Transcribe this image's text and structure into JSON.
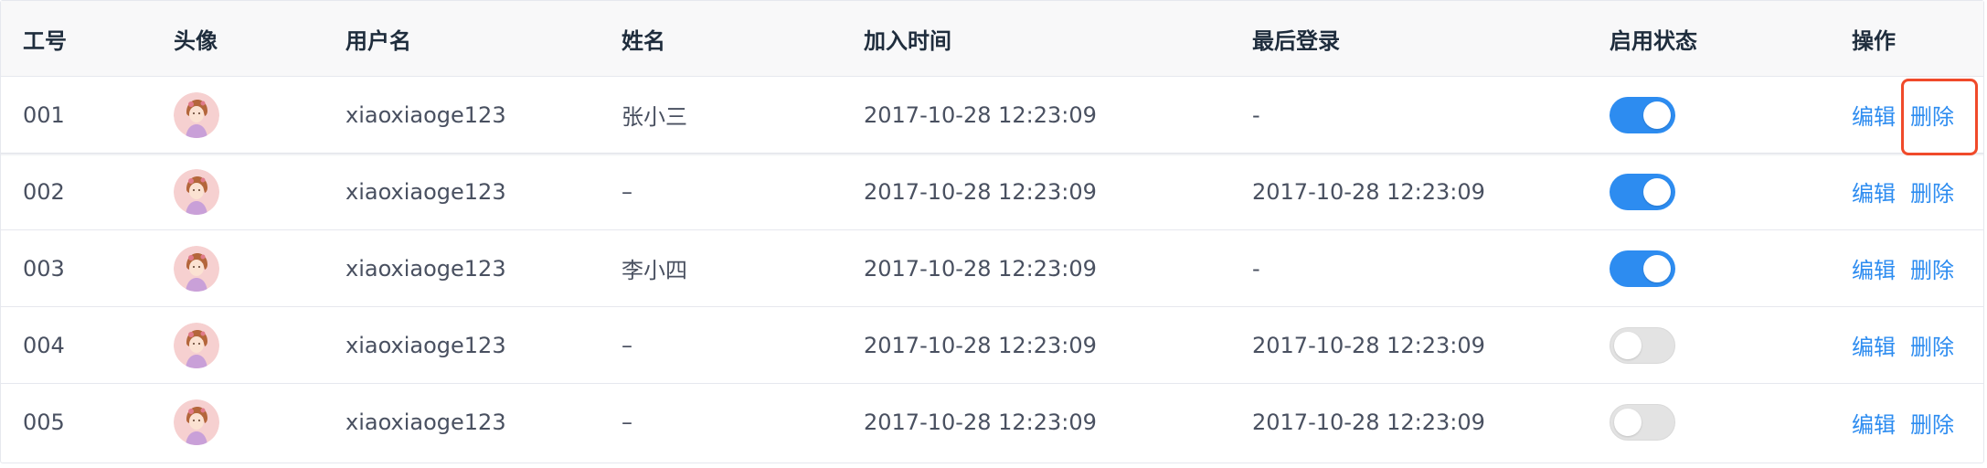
{
  "header": {
    "id": "工号",
    "avatar": "头像",
    "username": "用户名",
    "name": "姓名",
    "join_time": "加入时间",
    "last_login": "最后登录",
    "status": "启用状态",
    "actions": "操作"
  },
  "actions": {
    "edit": "编辑",
    "delete": "删除"
  },
  "rows": [
    {
      "id": "001",
      "username": "xiaoxiaoge123",
      "name": "张小三",
      "join_time": "2017-10-28 12:23:09",
      "last_login": "-",
      "enabled": true
    },
    {
      "id": "002",
      "username": "xiaoxiaoge123",
      "name": "–",
      "join_time": "2017-10-28 12:23:09",
      "last_login": "2017-10-28 12:23:09",
      "enabled": true
    },
    {
      "id": "003",
      "username": "xiaoxiaoge123",
      "name": "李小四",
      "join_time": "2017-10-28 12:23:09",
      "last_login": "-",
      "enabled": true
    },
    {
      "id": "004",
      "username": "xiaoxiaoge123",
      "name": "–",
      "join_time": "2017-10-28 12:23:09",
      "last_login": "2017-10-28 12:23:09",
      "enabled": false
    },
    {
      "id": "005",
      "username": "xiaoxiaoge123",
      "name": "–",
      "join_time": "2017-10-28 12:23:09",
      "last_login": "2017-10-28 12:23:09",
      "enabled": false
    }
  ],
  "colors": {
    "accent": "#2d8cf0",
    "switch_off": "#e3e3e3",
    "highlight": "#f04a2a",
    "header_bg": "#f8f8f9"
  },
  "icons": {
    "avatar": "user-avatar-icon"
  }
}
